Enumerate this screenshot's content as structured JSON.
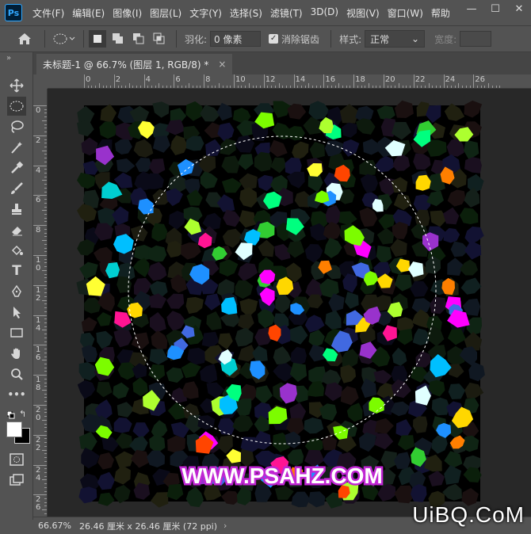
{
  "app": {
    "logo": "Ps"
  },
  "menu": [
    "文件(F)",
    "编辑(E)",
    "图像(I)",
    "图层(L)",
    "文字(Y)",
    "选择(S)",
    "滤镜(T)",
    "3D(D)",
    "视图(V)",
    "窗口(W)",
    "帮助"
  ],
  "window_controls": {
    "minimize": "—",
    "maximize": "☐",
    "close": "✕"
  },
  "options": {
    "feather_label": "羽化:",
    "feather_value": "0 像素",
    "antialias_label": "消除锯齿",
    "antialias_checked": true,
    "style_label": "样式:",
    "style_value": "正常",
    "width_label": "宽度:"
  },
  "tab": {
    "title": "未标题-1 @ 66.7% (图层 1, RGB/8) *",
    "close": "×"
  },
  "ruler_h": [
    "0",
    "2",
    "4",
    "6",
    "8",
    "10",
    "12",
    "14",
    "16",
    "18",
    "20",
    "22",
    "24",
    "26"
  ],
  "ruler_v": [
    "0",
    "2",
    "4",
    "6",
    "8",
    "1\n0",
    "1\n2",
    "1\n4",
    "1\n6",
    "1\n8",
    "2\n0",
    "2\n2",
    "2\n4",
    "2\n6"
  ],
  "canvas": {
    "text": "WWW.PSAHZ.COM",
    "text_color": "#ffffff",
    "text_stroke_color": "#c026d3",
    "background": "#000000"
  },
  "status": {
    "zoom": "66.67%",
    "info": "26.46 厘米 x 26.46 厘米 (72 ppi)"
  },
  "watermark": "UiBQ.CoM",
  "colors": {
    "foreground": "#ffffff",
    "background": "#000000"
  }
}
